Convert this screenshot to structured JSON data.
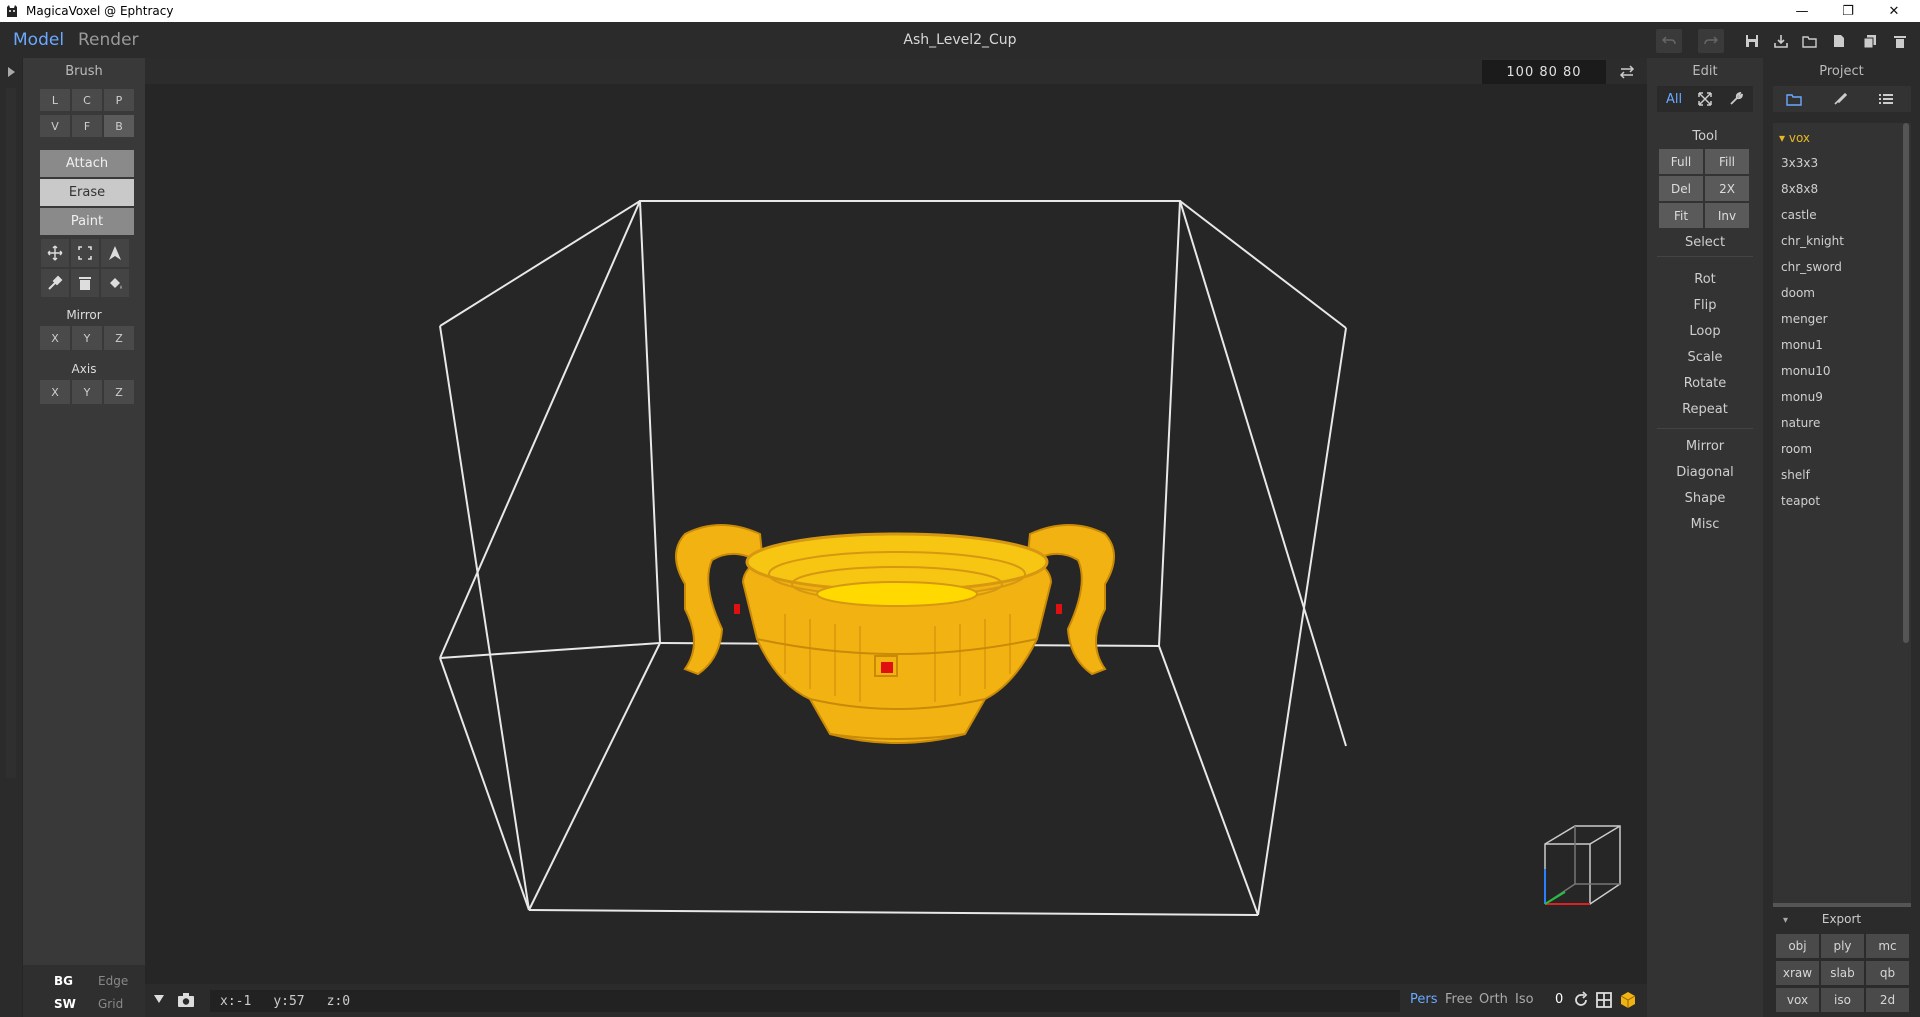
{
  "window": {
    "title": "MagicaVoxel @ Ephtracy",
    "minimize_icon": "minimize-icon",
    "maximize_icon": "restore-icon",
    "close_icon": "close-icon"
  },
  "header": {
    "modes": [
      "Model",
      "Render"
    ],
    "active_mode": "Model",
    "project_name": "Ash_Level2_Cup"
  },
  "brush": {
    "title": "Brush",
    "types_row1": [
      "L",
      "C",
      "P"
    ],
    "types_row2": [
      "V",
      "F",
      "B"
    ],
    "active_type": "B",
    "actions": [
      "Attach",
      "Erase",
      "Paint"
    ],
    "active_action": "Erase",
    "tool_icons": [
      "move-icon",
      "select-rect-icon",
      "cursor-icon",
      "eyedropper-icon",
      "trash-icon",
      "bucket-icon"
    ],
    "mirror_label": "Mirror",
    "mirror_axes": [
      "X",
      "Y",
      "Z"
    ],
    "axis_label": "Axis",
    "axis_axes": [
      "X",
      "Y",
      "Z"
    ]
  },
  "bottom_left": {
    "bg": "BG",
    "edge": "Edge",
    "sw": "SW",
    "grid": "Grid"
  },
  "viewport": {
    "size": "100  80  80",
    "status_x": "x:-1",
    "status_y": "y:57",
    "status_z": "z:0",
    "view_modes": [
      "Pers",
      "Free",
      "Orth",
      "Iso"
    ],
    "active_view": "Pers",
    "zoom_value": "0",
    "model_color": "#f2b312",
    "marker_color": "#e01010"
  },
  "edit": {
    "title": "Edit",
    "tabs": [
      "All"
    ],
    "tool_label": "Tool",
    "tool_buttons": [
      "Full",
      "Fill",
      "Del",
      "2X",
      "Fit",
      "Inv"
    ],
    "select_label": "Select",
    "ops": [
      "Rot",
      "Flip",
      "Loop",
      "Scale",
      "Rotate",
      "Repeat"
    ],
    "ops2": [
      "Mirror",
      "Diagonal",
      "Shape",
      "Misc"
    ]
  },
  "project": {
    "title": "Project",
    "folder": "vox",
    "items": [
      "3x3x3",
      "8x8x8",
      "castle",
      "chr_knight",
      "chr_sword",
      "doom",
      "menger",
      "monu1",
      "monu10",
      "monu9",
      "nature",
      "room",
      "shelf",
      "teapot"
    ],
    "export_title": "Export",
    "export_formats": [
      "obj",
      "ply",
      "mc",
      "xraw",
      "slab",
      "qb",
      "vox",
      "iso",
      "2d"
    ]
  },
  "colors": {
    "accent": "#6aa9ff",
    "folder": "#e8b820"
  }
}
